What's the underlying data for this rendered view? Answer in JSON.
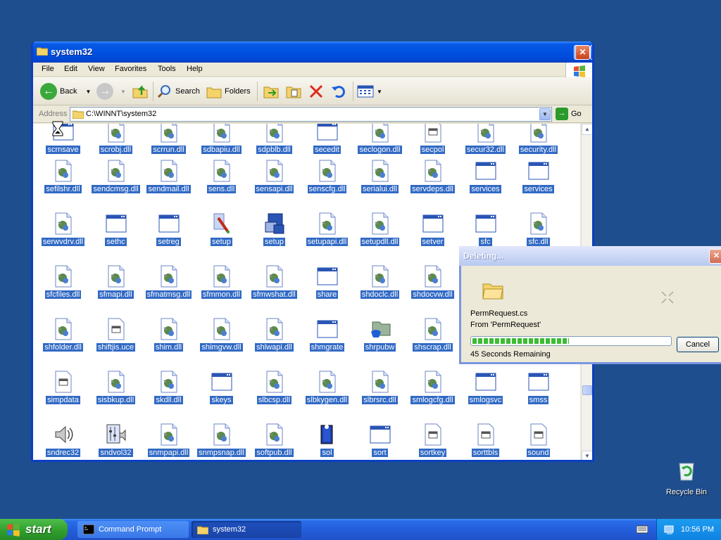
{
  "window": {
    "title": "system32",
    "menu": [
      "File",
      "Edit",
      "View",
      "Favorites",
      "Tools",
      "Help"
    ],
    "toolbar": {
      "back": "Back",
      "search": "Search",
      "folders": "Folders"
    },
    "address": {
      "label": "Address",
      "path": "C:\\WINNT\\system32",
      "go": "Go"
    }
  },
  "files": {
    "row0": [
      "scrnsave",
      "scrobj.dll",
      "scrrun.dll",
      "sdbapiu.dll",
      "sdpblb.dll",
      "secedit",
      "seclogon.dll",
      "secpol",
      "secur32.dll",
      "security.dll"
    ],
    "row1": [
      "sefilshr.dll",
      "sendcmsg.dll",
      "sendmail.dll",
      "sens.dll",
      "sensapi.dll",
      "senscfg.dll",
      "serialui.dll",
      "servdeps.dll",
      "services",
      "services"
    ],
    "row2": [
      "serwvdrv.dll",
      "sethc",
      "setreg",
      "setup",
      "setup",
      "setupapi.dll",
      "setupdll.dll",
      "setver",
      "sfc",
      "sfc.dll"
    ],
    "row3": [
      "sfcfiles.dll",
      "sfmapi.dll",
      "sfmatmsg.dll",
      "sfmmon.dll",
      "sfmwshat.dll",
      "share",
      "shdoclc.dll",
      "shdocvw.dll"
    ],
    "row4": [
      "shfolder.dll",
      "shiftjis.uce",
      "shim.dll",
      "shimgvw.dll",
      "shlwapi.dll",
      "shmgrate",
      "shrpubw",
      "shscrap.dll"
    ],
    "row5": [
      "simpdata",
      "sisbkup.dll",
      "skdll.dll",
      "skeys",
      "slbcsp.dll",
      "slbkygen.dll",
      "slbrsrc.dll",
      "smlogcfg.dll",
      "smlogsvc",
      "smss"
    ],
    "row6": [
      "sndrec32",
      "sndvol32",
      "snmpapi.dll",
      "snmpsnap.dll",
      "softpub.dll",
      "sol",
      "sort",
      "sortkey",
      "sorttbls",
      "sound"
    ]
  },
  "dialog": {
    "title": "Deleting...",
    "file": "PermRequest.cs",
    "from": "From 'PermRequest'",
    "progress": 0.49,
    "remaining": "45 Seconds Remaining",
    "cancel": "Cancel"
  },
  "desktop": {
    "recycle_bin": "Recycle Bin"
  },
  "taskbar": {
    "start": "start",
    "tasks": [
      "Command Prompt",
      "system32"
    ],
    "clock": "10:56 PM"
  },
  "colors": {
    "selection": "#316ac5",
    "desktop": "#1f4e8f",
    "title_bar": "#0050e0"
  }
}
